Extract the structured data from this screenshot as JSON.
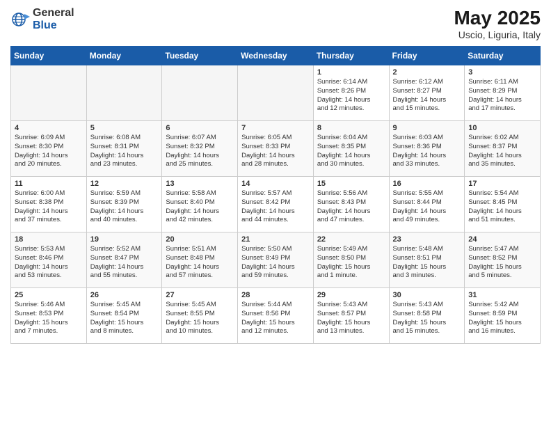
{
  "header": {
    "logo_general": "General",
    "logo_blue": "Blue",
    "month_year": "May 2025",
    "location": "Uscio, Liguria, Italy"
  },
  "days_of_week": [
    "Sunday",
    "Monday",
    "Tuesday",
    "Wednesday",
    "Thursday",
    "Friday",
    "Saturday"
  ],
  "weeks": [
    [
      {
        "day": "",
        "empty": true
      },
      {
        "day": "",
        "empty": true
      },
      {
        "day": "",
        "empty": true
      },
      {
        "day": "",
        "empty": true
      },
      {
        "day": "1",
        "sunrise": "6:14 AM",
        "sunset": "8:26 PM",
        "daylight": "14 hours and 12 minutes."
      },
      {
        "day": "2",
        "sunrise": "6:12 AM",
        "sunset": "8:27 PM",
        "daylight": "14 hours and 15 minutes."
      },
      {
        "day": "3",
        "sunrise": "6:11 AM",
        "sunset": "8:29 PM",
        "daylight": "14 hours and 17 minutes."
      }
    ],
    [
      {
        "day": "4",
        "sunrise": "6:09 AM",
        "sunset": "8:30 PM",
        "daylight": "14 hours and 20 minutes."
      },
      {
        "day": "5",
        "sunrise": "6:08 AM",
        "sunset": "8:31 PM",
        "daylight": "14 hours and 23 minutes."
      },
      {
        "day": "6",
        "sunrise": "6:07 AM",
        "sunset": "8:32 PM",
        "daylight": "14 hours and 25 minutes."
      },
      {
        "day": "7",
        "sunrise": "6:05 AM",
        "sunset": "8:33 PM",
        "daylight": "14 hours and 28 minutes."
      },
      {
        "day": "8",
        "sunrise": "6:04 AM",
        "sunset": "8:35 PM",
        "daylight": "14 hours and 30 minutes."
      },
      {
        "day": "9",
        "sunrise": "6:03 AM",
        "sunset": "8:36 PM",
        "daylight": "14 hours and 33 minutes."
      },
      {
        "day": "10",
        "sunrise": "6:02 AM",
        "sunset": "8:37 PM",
        "daylight": "14 hours and 35 minutes."
      }
    ],
    [
      {
        "day": "11",
        "sunrise": "6:00 AM",
        "sunset": "8:38 PM",
        "daylight": "14 hours and 37 minutes."
      },
      {
        "day": "12",
        "sunrise": "5:59 AM",
        "sunset": "8:39 PM",
        "daylight": "14 hours and 40 minutes."
      },
      {
        "day": "13",
        "sunrise": "5:58 AM",
        "sunset": "8:40 PM",
        "daylight": "14 hours and 42 minutes."
      },
      {
        "day": "14",
        "sunrise": "5:57 AM",
        "sunset": "8:42 PM",
        "daylight": "14 hours and 44 minutes."
      },
      {
        "day": "15",
        "sunrise": "5:56 AM",
        "sunset": "8:43 PM",
        "daylight": "14 hours and 47 minutes."
      },
      {
        "day": "16",
        "sunrise": "5:55 AM",
        "sunset": "8:44 PM",
        "daylight": "14 hours and 49 minutes."
      },
      {
        "day": "17",
        "sunrise": "5:54 AM",
        "sunset": "8:45 PM",
        "daylight": "14 hours and 51 minutes."
      }
    ],
    [
      {
        "day": "18",
        "sunrise": "5:53 AM",
        "sunset": "8:46 PM",
        "daylight": "14 hours and 53 minutes."
      },
      {
        "day": "19",
        "sunrise": "5:52 AM",
        "sunset": "8:47 PM",
        "daylight": "14 hours and 55 minutes."
      },
      {
        "day": "20",
        "sunrise": "5:51 AM",
        "sunset": "8:48 PM",
        "daylight": "14 hours and 57 minutes."
      },
      {
        "day": "21",
        "sunrise": "5:50 AM",
        "sunset": "8:49 PM",
        "daylight": "14 hours and 59 minutes."
      },
      {
        "day": "22",
        "sunrise": "5:49 AM",
        "sunset": "8:50 PM",
        "daylight": "15 hours and 1 minute."
      },
      {
        "day": "23",
        "sunrise": "5:48 AM",
        "sunset": "8:51 PM",
        "daylight": "15 hours and 3 minutes."
      },
      {
        "day": "24",
        "sunrise": "5:47 AM",
        "sunset": "8:52 PM",
        "daylight": "15 hours and 5 minutes."
      }
    ],
    [
      {
        "day": "25",
        "sunrise": "5:46 AM",
        "sunset": "8:53 PM",
        "daylight": "15 hours and 7 minutes."
      },
      {
        "day": "26",
        "sunrise": "5:45 AM",
        "sunset": "8:54 PM",
        "daylight": "15 hours and 8 minutes."
      },
      {
        "day": "27",
        "sunrise": "5:45 AM",
        "sunset": "8:55 PM",
        "daylight": "15 hours and 10 minutes."
      },
      {
        "day": "28",
        "sunrise": "5:44 AM",
        "sunset": "8:56 PM",
        "daylight": "15 hours and 12 minutes."
      },
      {
        "day": "29",
        "sunrise": "5:43 AM",
        "sunset": "8:57 PM",
        "daylight": "15 hours and 13 minutes."
      },
      {
        "day": "30",
        "sunrise": "5:43 AM",
        "sunset": "8:58 PM",
        "daylight": "15 hours and 15 minutes."
      },
      {
        "day": "31",
        "sunrise": "5:42 AM",
        "sunset": "8:59 PM",
        "daylight": "15 hours and 16 minutes."
      }
    ]
  ],
  "labels": {
    "sunrise": "Sunrise:",
    "sunset": "Sunset:",
    "daylight": "Daylight hours"
  }
}
